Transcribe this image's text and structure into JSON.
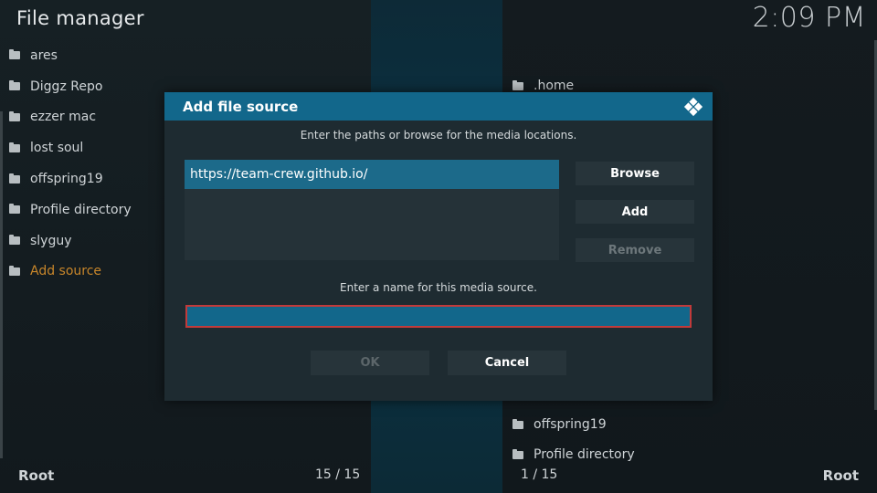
{
  "app": {
    "title": "File manager",
    "clock": "2:09 PM"
  },
  "left_panel": {
    "items": [
      {
        "label": "ares"
      },
      {
        "label": "Diggz Repo"
      },
      {
        "label": "ezzer mac"
      },
      {
        "label": "lost soul"
      },
      {
        "label": "offspring19"
      },
      {
        "label": "Profile directory"
      },
      {
        "label": "slyguy"
      },
      {
        "label": "Add source"
      }
    ],
    "footer_label": "Root",
    "count": "15 / 15"
  },
  "right_panel": {
    "visible_items": [
      {
        "label": ".home"
      },
      {
        "label": "offspring19"
      },
      {
        "label": "Profile directory"
      }
    ],
    "footer_label": "Root",
    "count": "1 / 15"
  },
  "dialog": {
    "title": "Add file source",
    "paths_prompt": "Enter the paths or browse for the media locations.",
    "paths": [
      "https://team-crew.github.io/"
    ],
    "buttons": {
      "browse": "Browse",
      "add": "Add",
      "remove": "Remove"
    },
    "name_prompt": "Enter a name for this media source.",
    "name_value": "",
    "ok": "OK",
    "cancel": "Cancel"
  },
  "colors": {
    "accent_blue": "#12678b",
    "focus_red": "#c23a3a",
    "active_orange": "#c8862a"
  }
}
